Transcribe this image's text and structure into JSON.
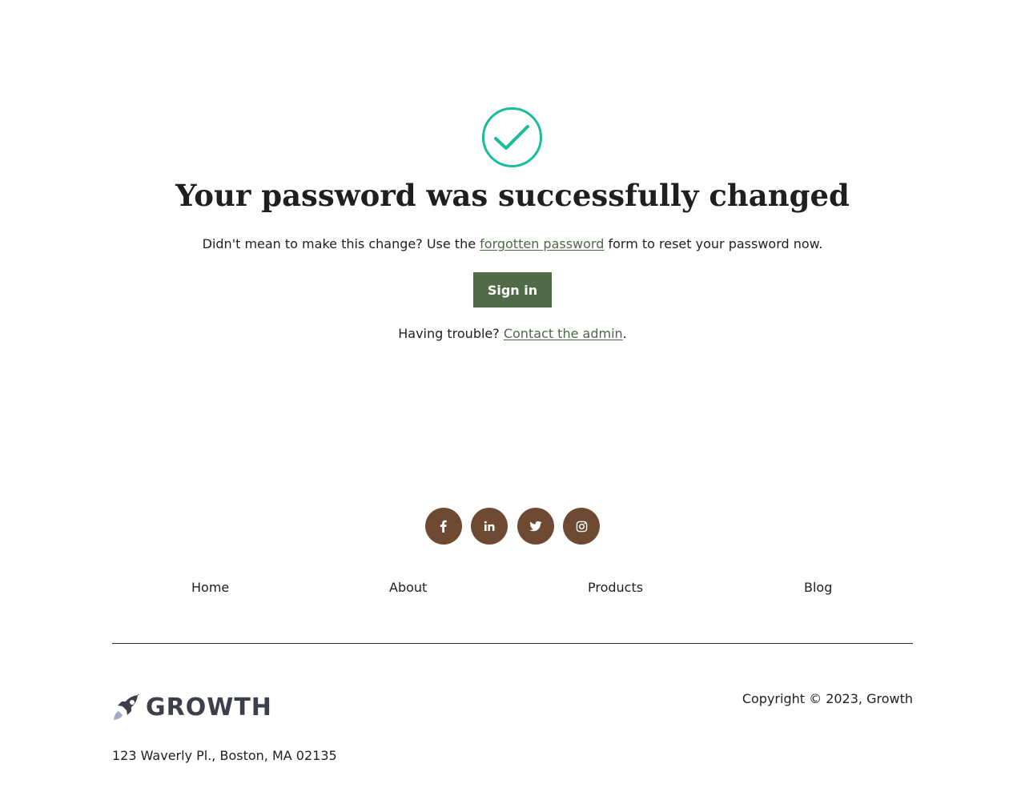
{
  "main": {
    "title": "Your password was successfully changed",
    "subline_prefix": "Didn't mean to make this change? Use the ",
    "forgot_link": "forgotten password",
    "subline_suffix": " form to reset your password now.",
    "signin_label": "Sign in",
    "trouble_prefix": "Having trouble? ",
    "contact_link": "Contact the admin",
    "trouble_suffix": "."
  },
  "footer": {
    "social": [
      {
        "icon": "facebook-icon"
      },
      {
        "icon": "linkedin-icon"
      },
      {
        "icon": "twitter-icon"
      },
      {
        "icon": "instagram-icon"
      }
    ],
    "nav": [
      {
        "label": "Home"
      },
      {
        "label": "About"
      },
      {
        "label": "Products"
      },
      {
        "label": "Blog"
      }
    ],
    "logo_text": "GROWTH",
    "copyright": "Copyright © 2023, Growth",
    "address": "123 Waverly Pl., Boston, MA 02135"
  },
  "colors": {
    "accent": "#516a47",
    "success": "#1abc9c",
    "social_bg": "#6e4a33",
    "logo": "#3d3f4a"
  }
}
